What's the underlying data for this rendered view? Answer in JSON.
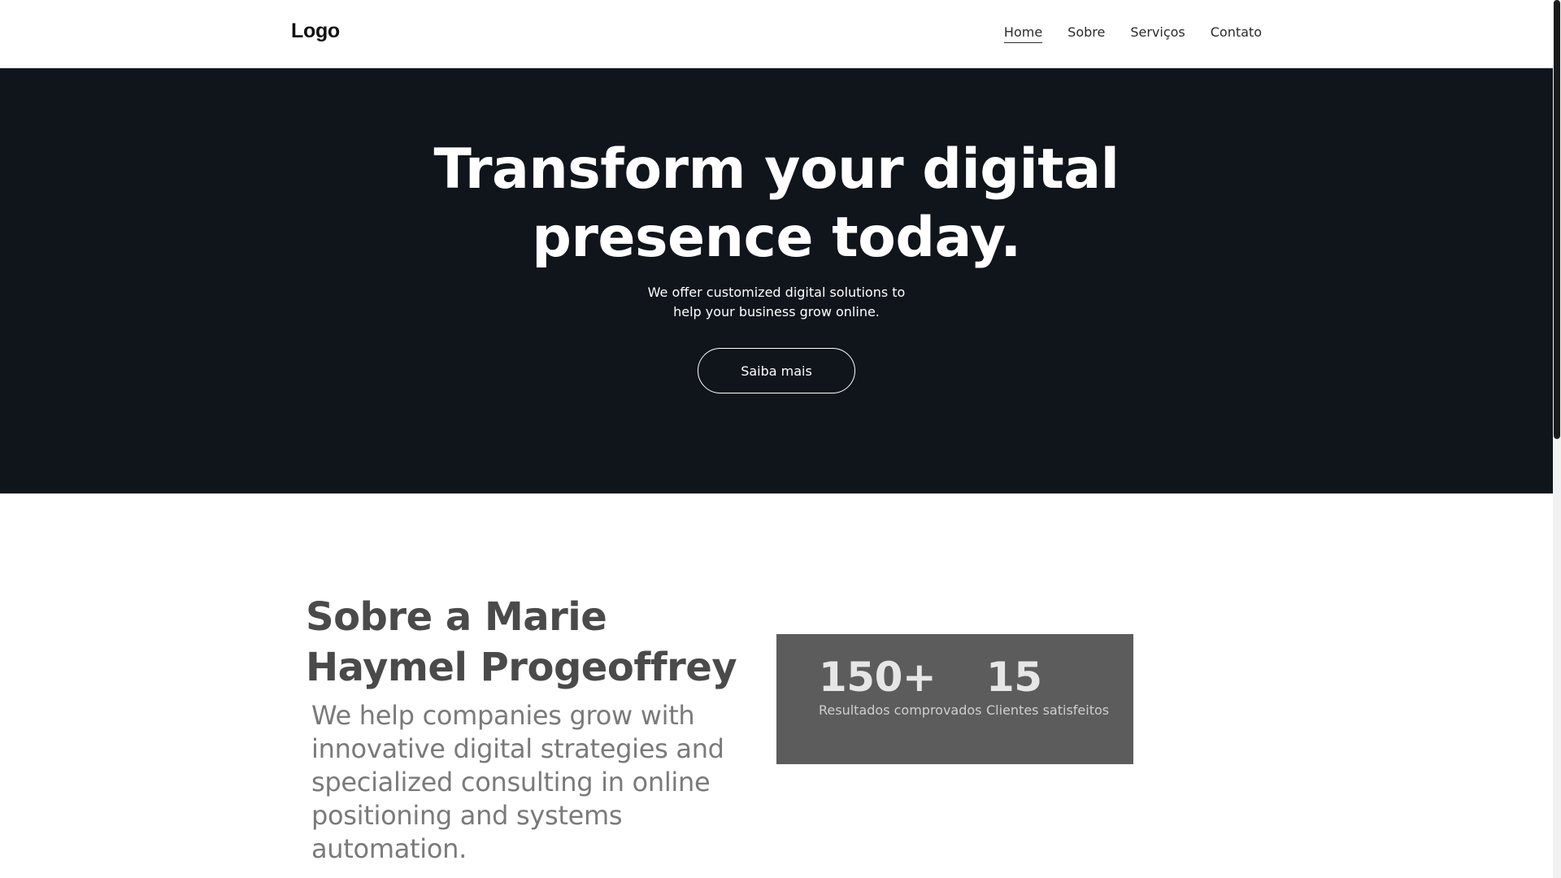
{
  "header": {
    "logo": "Logo",
    "nav": [
      {
        "label": "Home",
        "active": true
      },
      {
        "label": "Sobre",
        "active": false
      },
      {
        "label": "Serviços",
        "active": false
      },
      {
        "label": "Contato",
        "active": false
      }
    ]
  },
  "hero": {
    "title_lines": [
      "Transform your digital",
      "presence today."
    ],
    "subtitle_lines": [
      "We offer customized digital solutions to",
      "help your business grow online."
    ],
    "button_label": "Saiba mais",
    "background_color": "#0f151b"
  },
  "about": {
    "title_lines": [
      "Sobre a Marie",
      "Haymel Progeoffrey"
    ],
    "text_lines": [
      "We help companies grow with",
      "innovative digital strategies and",
      "specialized consulting in online",
      "positioning and systems",
      "automation."
    ],
    "stats": [
      {
        "value": "150+",
        "label": "Resultados comprovados"
      },
      {
        "value": "15",
        "label": "Clientes satisfeitos"
      }
    ],
    "card_color": "#5c5c5c"
  }
}
